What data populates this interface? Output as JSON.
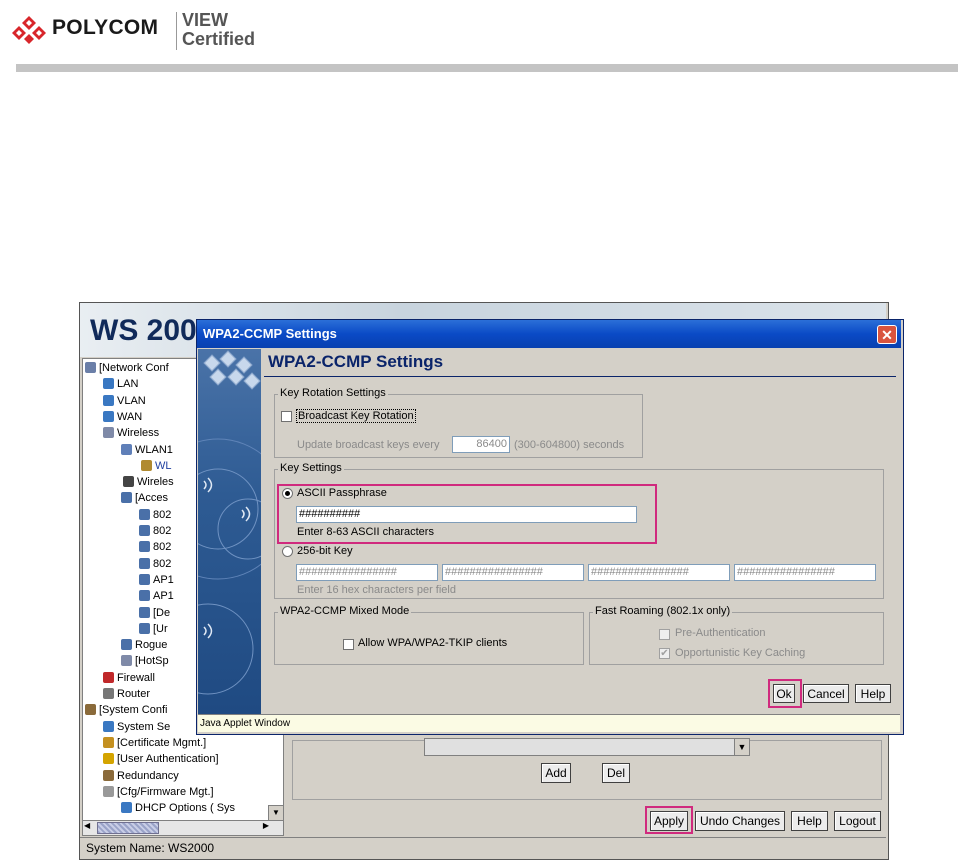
{
  "header": {
    "brand": "POLYCOM",
    "badge_line1": "VIEW",
    "badge_line2": "Certified"
  },
  "app": {
    "banner_title": "WS 200",
    "status_bar": "System Name: WS2000",
    "tree": [
      {
        "label": "[Network Conf",
        "icon": "network-icon"
      },
      {
        "label": "LAN",
        "icon": "globe-icon"
      },
      {
        "label": "VLAN",
        "icon": "globe-icon"
      },
      {
        "label": "WAN",
        "icon": "globe-icon"
      },
      {
        "label": "Wireless",
        "icon": "wireless-icon"
      },
      {
        "label": "WLAN1",
        "icon": "antenna-icon"
      },
      {
        "label": "WL",
        "icon": "key-icon"
      },
      {
        "label": "Wireles",
        "icon": "search-icon"
      },
      {
        "label": "[Acces",
        "icon": "access-point-icon"
      },
      {
        "label": "802",
        "icon": "access-point-icon"
      },
      {
        "label": "802",
        "icon": "access-point-icon"
      },
      {
        "label": "802",
        "icon": "access-point-icon"
      },
      {
        "label": "802",
        "icon": "access-point-icon"
      },
      {
        "label": "AP1",
        "icon": "access-point-icon"
      },
      {
        "label": "AP1",
        "icon": "access-point-icon"
      },
      {
        "label": "[De",
        "icon": "access-point-icon"
      },
      {
        "label": "[Ur",
        "icon": "access-point-icon"
      },
      {
        "label": "Rogue",
        "icon": "access-point-icon"
      },
      {
        "label": "[HotSp",
        "icon": "wireless-icon"
      },
      {
        "label": "Firewall",
        "icon": "firewall-icon"
      },
      {
        "label": "Router",
        "icon": "router-icon"
      },
      {
        "label": "[System Confi",
        "icon": "tools-icon"
      },
      {
        "label": "System Se",
        "icon": "globe-icon"
      },
      {
        "label": "[Certificate Mgmt.]",
        "icon": "certificate-icon"
      },
      {
        "label": "[User Authentication]",
        "icon": "user-icon"
      },
      {
        "label": "Redundancy",
        "icon": "tools-icon"
      },
      {
        "label": "[Cfg/Firmware Mgt.]",
        "icon": "disc-icon"
      },
      {
        "label": "DHCP Options ( Sys",
        "icon": "globe-icon"
      }
    ],
    "add_label": "Add",
    "del_label": "Del",
    "apply_label": "Apply",
    "undo_label": "Undo Changes",
    "help_label": "Help",
    "logout_label": "Logout"
  },
  "dialog": {
    "window_title": "WPA2-CCMP Settings",
    "heading": "WPA2-CCMP Settings",
    "close_label": "✕",
    "key_rotation": {
      "legend": "Key Rotation Settings",
      "broadcast_label": "Broadcast Key Rotation",
      "update_label": "Update broadcast keys every",
      "update_value": "86400",
      "range_label": "(300-604800) seconds"
    },
    "key_settings": {
      "legend": "Key Settings",
      "ascii_label": "ASCII Passphrase",
      "ascii_value": "##########",
      "ascii_hint": "Enter 8-63 ASCII characters",
      "key256_label": "256-bit Key",
      "key256_fields": [
        "################",
        "################",
        "################",
        "################"
      ],
      "key256_hint": "Enter 16 hex characters per field"
    },
    "mixed_mode": {
      "legend": "WPA2-CCMP Mixed Mode",
      "allow_label": "Allow WPA/WPA2-TKIP clients"
    },
    "fast_roaming": {
      "legend": "Fast Roaming (802.1x only)",
      "preauth_label": "Pre-Authentication",
      "okc_label": "Opportunistic Key Caching"
    },
    "ok_label": "Ok",
    "cancel_label": "Cancel",
    "help_label": "Help",
    "footer": "Java Applet Window"
  },
  "colors": {
    "highlight": "#d02a7e",
    "title_bar": "#0a4ac6",
    "panel": "#d4d0c8"
  }
}
